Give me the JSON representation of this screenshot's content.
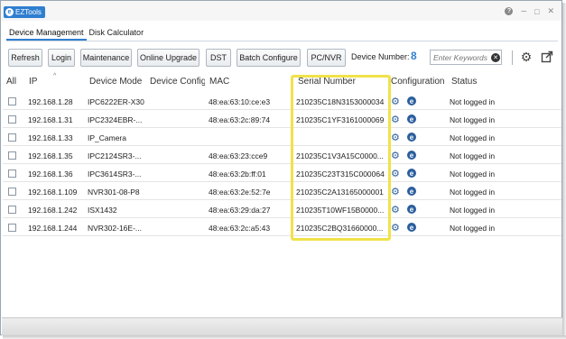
{
  "app": {
    "title": "EZTools",
    "logo_letter": "e"
  },
  "window_controls": {
    "help": "?",
    "minimize": "–",
    "maximize": "□",
    "close": "✕"
  },
  "tabs": [
    {
      "label": "Device Management",
      "active": true
    },
    {
      "label": "Disk Calculator",
      "active": false
    }
  ],
  "toolbar": {
    "buttons": [
      "Refresh",
      "Login",
      "Maintenance",
      "Online Upgrade",
      "DST",
      "Batch Configure",
      "PC/NVR"
    ],
    "device_number_label": "Device Number:",
    "device_number": "8",
    "search_placeholder": "Enter Keywords",
    "settings_icon": "gear-icon",
    "export_icon": "export-icon"
  },
  "table": {
    "headers": [
      "All",
      "IP",
      "Device Mode",
      "Device Config",
      "MAC",
      "Serial Number",
      "Configuration",
      "Status"
    ],
    "rows": [
      {
        "ip": "192.168.1.28",
        "model": "IPC6222ER-X30",
        "mac": "48:ea:63:10:ce:e3",
        "serial": "210235C18N3153000034",
        "status": "Not logged in"
      },
      {
        "ip": "192.168.1.31",
        "model": "IPC2324EBR-...",
        "mac": "48:ea:63:2c:89:74",
        "serial": "210235C1YF3161000069",
        "status": "Not logged in"
      },
      {
        "ip": "192.168.1.33",
        "model": "IP_Camera",
        "mac": "",
        "serial": "",
        "status": "Not logged in"
      },
      {
        "ip": "192.168.1.35",
        "model": "IPC2124SR3-...",
        "mac": "48:ea:63:23:cce9",
        "serial": "210235C1V3A15C0000...",
        "status": "Not logged in"
      },
      {
        "ip": "192.168.1.36",
        "model": "IPC3614SR3-...",
        "mac": "48:ea:63:2b:ff:01",
        "serial": "210235C23T315C000064",
        "status": "Not logged in"
      },
      {
        "ip": "192.168.1.109",
        "model": "NVR301-08-P8",
        "mac": "48:ea:63:2e:52:7e",
        "serial": "210235C2A13165000001",
        "status": "Not logged in"
      },
      {
        "ip": "192.168.1.242",
        "model": "ISX1432",
        "mac": "48:ea:63:29:da:27",
        "serial": "210235T10WF15B0000...",
        "status": "Not logged in"
      },
      {
        "ip": "192.168.1.244",
        "model": "NVR302-16E-...",
        "mac": "48:ea:63:2c:a5:43",
        "serial": "210235C2BQ31660000...",
        "status": "Not logged in"
      }
    ]
  },
  "colors": {
    "accent": "#2f7fd0",
    "highlight": "#f0e24a",
    "icon": "#2b5e9e"
  }
}
